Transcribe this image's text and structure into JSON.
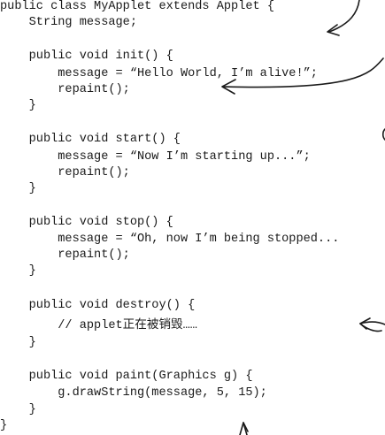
{
  "code": {
    "lines": [
      "public class MyApplet extends Applet {",
      "    String message;",
      "",
      "    public void init() {",
      "        message = “Hello World, I’m alive!”;",
      "        repaint();",
      "    }",
      "",
      "    public void start() {",
      "        message = “Now I’m starting up...”;",
      "        repaint();",
      "    }",
      "",
      "    public void stop() {",
      "        message = “Oh, now I’m being stopped...",
      "        repaint();",
      "    }",
      "",
      "    public void destroy() {",
      "        // applet正在被销毁……",
      "    }",
      "",
      "    public void paint(Graphics g) {",
      "        g.drawString(message, 5, 15);",
      "    }",
      "}"
    ]
  },
  "annotations": {
    "icons": [
      "curved-arrow-icon",
      "curved-arrow-icon",
      "curved-arrow-icon",
      "curved-arrow-icon",
      "arrow-up-icon"
    ]
  }
}
